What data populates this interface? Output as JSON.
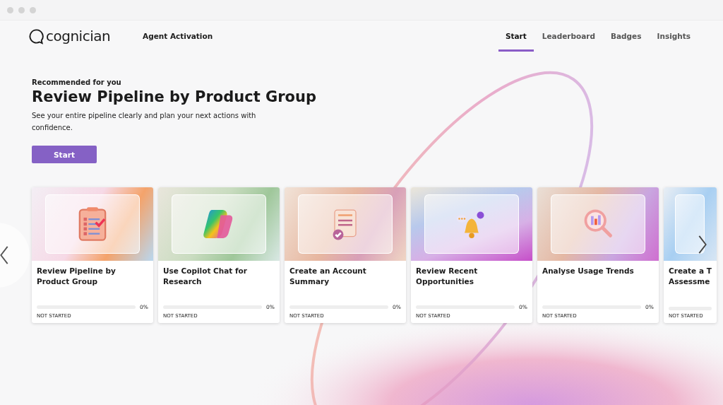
{
  "brand": {
    "name": "cognician"
  },
  "program": "Agent Activation",
  "tabs": [
    {
      "label": "Start",
      "selected": true
    },
    {
      "label": "Leaderboard",
      "selected": false
    },
    {
      "label": "Badges",
      "selected": false
    },
    {
      "label": "Insights",
      "selected": false
    }
  ],
  "hero": {
    "eyebrow": "Recommended for you",
    "title": "Review Pipeline by Product Group",
    "description": "See your entire pipeline clearly and plan your next actions with confidence.",
    "button": "Start"
  },
  "cards": [
    {
      "title": "Review Pipeline by Product Group",
      "level": 0,
      "percent": "0%",
      "status": "NOT STARTED",
      "partial": false
    },
    {
      "title": "Use Copilot Chat for Research",
      "level": 0,
      "percent": "0%",
      "status": "NOT STARTED",
      "partial": false
    },
    {
      "title": "Create an Account Summary",
      "level": 0,
      "percent": "0%",
      "status": "NOT STARTED",
      "partial": false
    },
    {
      "title": "Review Recent Opportunities",
      "level": 0,
      "percent": "0%",
      "status": "NOT STARTED",
      "partial": false
    },
    {
      "title": "Analyse Usage Trends",
      "level": 0,
      "percent": "0%",
      "status": "NOT STARTED",
      "partial": false
    },
    {
      "title": "Create a T\nAssessme",
      "level": 0,
      "status": "NOT STARTED",
      "partial": true
    }
  ]
}
